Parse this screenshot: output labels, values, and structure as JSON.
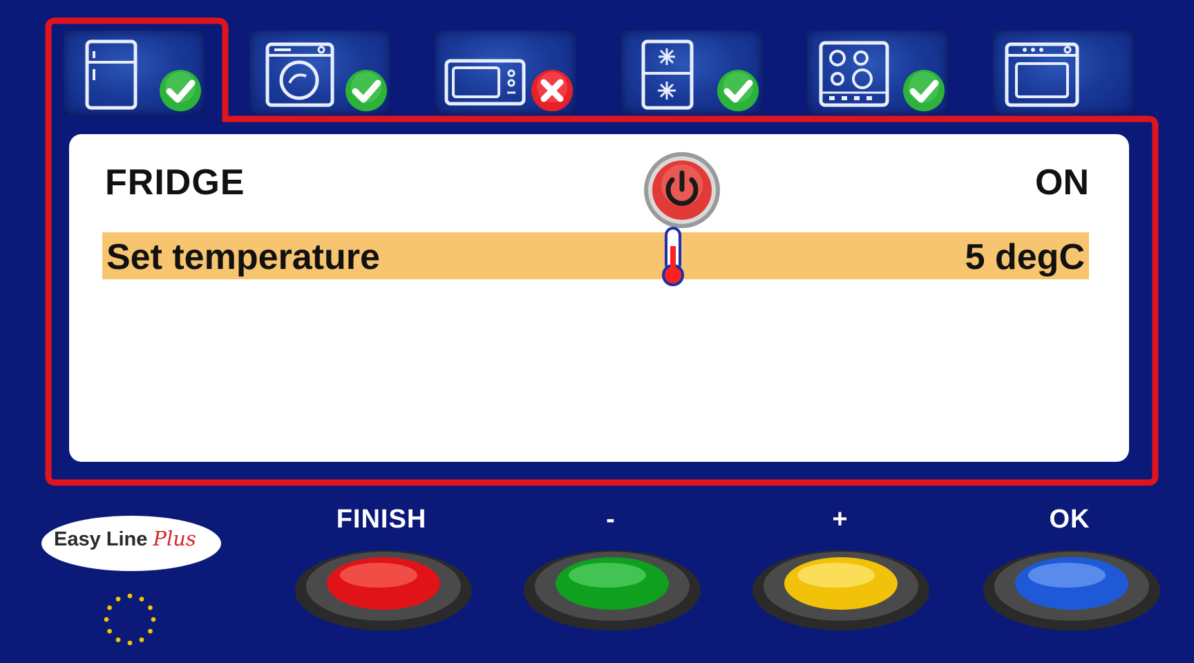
{
  "tabs": [
    {
      "name": "fridge",
      "status": "ok"
    },
    {
      "name": "washing-machine",
      "status": "ok"
    },
    {
      "name": "microwave",
      "status": "error"
    },
    {
      "name": "freezer",
      "status": "ok"
    },
    {
      "name": "hob",
      "status": "ok"
    },
    {
      "name": "oven",
      "status": "none"
    }
  ],
  "panel": {
    "appliance_name": "FRIDGE",
    "power_state": "ON",
    "setting_label": "Set temperature",
    "setting_value": "5 degC"
  },
  "logo": {
    "text_main": "Easy Line ",
    "text_plus": "Plus"
  },
  "buttons": {
    "finish_label": "FINISH",
    "minus_label": "-",
    "plus_label": "+",
    "ok_label": "OK"
  },
  "colors": {
    "background": "#0b1a78",
    "frame": "#e0141e",
    "highlight_row": "#f7c46f",
    "button_red": "#e01418",
    "button_green": "#10a020",
    "button_yellow": "#f2c20a",
    "button_blue": "#1e5ad8",
    "status_ok": "#2cb33a",
    "status_error": "#e8202a"
  }
}
